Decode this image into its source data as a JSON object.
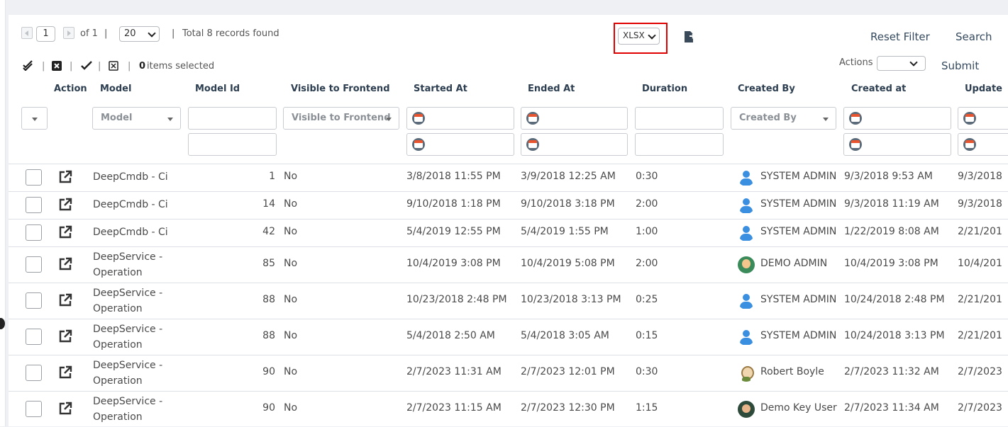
{
  "pagination": {
    "page": "1",
    "of_label": "of 1",
    "sep1": "|",
    "page_size": "20",
    "sep2": "|",
    "total": "Total 8 records found"
  },
  "export": {
    "format": "XLSX"
  },
  "toolbar": {
    "reset_filter": "Reset Filter",
    "search": "Search",
    "actions_label": "Actions",
    "submit": "Submit",
    "selected_count": "0",
    "selected_label": "items selected",
    "pipe": "|"
  },
  "columns": {
    "action": "Action",
    "model": "Model",
    "model_id": "Model Id",
    "visible": "Visible to Frontend",
    "started": "Started At",
    "ended": "Ended At",
    "duration": "Duration",
    "created_by": "Created By",
    "created_at": "Created at",
    "updated": "Update"
  },
  "filters": {
    "model_placeholder": "Model",
    "visible_placeholder": "Visible to Frontend",
    "created_by_placeholder": "Created By"
  },
  "rows": [
    {
      "model": "DeepCmdb - Ci",
      "model_id": "1",
      "visible": "No",
      "started": "3/8/2018 11:55 PM",
      "ended": "3/9/2018 12:25 AM",
      "duration": "0:30",
      "avatar": "system-admin-avatar",
      "created_by": "SYSTEM ADMIN",
      "created_at": "9/3/2018 9:53 AM",
      "updated": "9/3/2018"
    },
    {
      "model": "DeepCmdb - Ci",
      "model_id": "14",
      "visible": "No",
      "started": "9/10/2018 1:18 PM",
      "ended": "9/10/2018 3:18 PM",
      "duration": "2:00",
      "avatar": "system-admin-avatar",
      "created_by": "SYSTEM ADMIN",
      "created_at": "9/3/2018 11:19 AM",
      "updated": "9/3/2018"
    },
    {
      "model": "DeepCmdb - Ci",
      "model_id": "42",
      "visible": "No",
      "started": "5/4/2019 12:55 PM",
      "ended": "5/4/2019 1:55 PM",
      "duration": "1:00",
      "avatar": "system-admin-avatar",
      "created_by": "SYSTEM ADMIN",
      "created_at": "1/22/2019 8:08 AM",
      "updated": "2/21/201"
    },
    {
      "model": "DeepService - Operation",
      "model_id": "85",
      "visible": "No",
      "started": "10/4/2019 3:08 PM",
      "ended": "10/4/2019 5:08 PM",
      "duration": "2:00",
      "avatar": "demo-admin-avatar",
      "created_by": "DEMO ADMIN",
      "created_at": "10/4/2019 3:08 PM",
      "updated": "10/4/201"
    },
    {
      "model": "DeepService - Operation",
      "model_id": "88",
      "visible": "No",
      "started": "10/23/2018 2:48 PM",
      "ended": "10/23/2018 3:13 PM",
      "duration": "0:25",
      "avatar": "system-admin-avatar",
      "created_by": "SYSTEM ADMIN",
      "created_at": "10/24/2018 2:48 PM",
      "updated": "2/21/201"
    },
    {
      "model": "DeepService - Operation",
      "model_id": "88",
      "visible": "No",
      "started": "5/4/2018 2:50 AM",
      "ended": "5/4/2018 3:05 AM",
      "duration": "0:15",
      "avatar": "system-admin-avatar",
      "created_by": "SYSTEM ADMIN",
      "created_at": "10/24/2018 3:13 PM",
      "updated": "2/21/201"
    },
    {
      "model": "DeepService - Operation",
      "model_id": "90",
      "visible": "No",
      "started": "2/7/2023 11:31 AM",
      "ended": "2/7/2023 12:01 PM",
      "duration": "0:30",
      "avatar": "robert-boyle-avatar",
      "created_by": "Robert Boyle",
      "created_at": "2/7/2023 11:32 AM",
      "updated": "2/7/2023"
    },
    {
      "model": "DeepService - Operation",
      "model_id": "90",
      "visible": "No",
      "started": "2/7/2023 11:15 AM",
      "ended": "2/7/2023 12:30 PM",
      "duration": "1:15",
      "avatar": "demo-key-user-avatar",
      "created_by": "Demo Key User",
      "created_at": "2/7/2023 11:34 AM",
      "updated": "2/7/2023"
    }
  ]
}
